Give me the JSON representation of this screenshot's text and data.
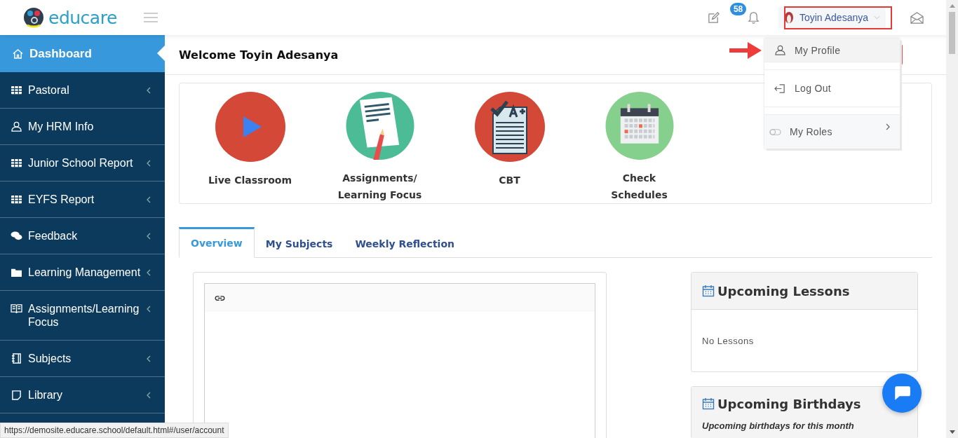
{
  "header": {
    "logo_text": "educare",
    "notification_count": "58",
    "user_name": "Toyin Adesanya"
  },
  "user_menu": [
    {
      "label": "My Profile",
      "kind": "user",
      "selected": true,
      "submenu": false
    },
    {
      "label": "Log Out",
      "kind": "logout",
      "selected": false,
      "submenu": false
    },
    {
      "label": "My Roles",
      "kind": "toggle",
      "selected": false,
      "submenu": true
    }
  ],
  "sidebar": {
    "items": [
      {
        "label": "Dashboard",
        "kind": "home",
        "selected": true,
        "submenu": false
      },
      {
        "label": "Pastoral",
        "kind": "grid",
        "selected": false,
        "submenu": true
      },
      {
        "label": "My HRM Info",
        "kind": "user",
        "selected": false,
        "submenu": false
      },
      {
        "label": "Junior School Report",
        "kind": "grid",
        "selected": false,
        "submenu": true
      },
      {
        "label": "EYFS Report",
        "kind": "grid",
        "selected": false,
        "submenu": true
      },
      {
        "label": "Feedback",
        "kind": "chat",
        "selected": false,
        "submenu": true
      },
      {
        "label": "Learning Management",
        "kind": "folder",
        "selected": false,
        "submenu": true
      },
      {
        "label": "Assignments/Learning Focus",
        "kind": "book",
        "selected": false,
        "submenu": true
      },
      {
        "label": "Subjects",
        "kind": "notebook",
        "selected": false,
        "submenu": true
      },
      {
        "label": "Library",
        "kind": "note",
        "selected": false,
        "submenu": true
      }
    ]
  },
  "welcome": "Welcome Toyin Adesanya",
  "shortcuts": [
    {
      "label": "Live Classroom",
      "kind": "play"
    },
    {
      "label": "Assignments/\nLearning Focus",
      "kind": "assignment"
    },
    {
      "label": "CBT",
      "kind": "cbt"
    },
    {
      "label": "Check\nSchedules",
      "kind": "calendar"
    }
  ],
  "tabs": [
    {
      "label": "Overview",
      "selected": true
    },
    {
      "label": "My Subjects",
      "selected": false
    },
    {
      "label": "Weekly Reflection",
      "selected": false
    }
  ],
  "upcoming_lessons": {
    "title": "Upcoming Lessons",
    "empty_text": "No Lessons"
  },
  "upcoming_birthdays": {
    "title": "Upcoming Birthdays",
    "subtitle": "Upcoming birthdays for this month"
  },
  "status_url": "https://demosite.educare.school/default.html#/user/account"
}
